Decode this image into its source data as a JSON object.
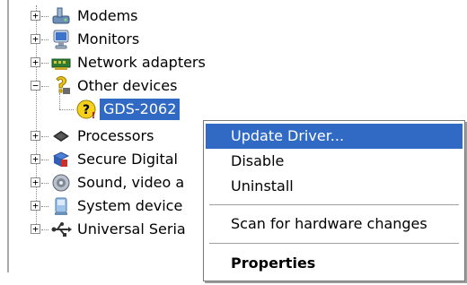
{
  "tree": {
    "items": [
      {
        "label": "Modems",
        "icon": "modem-icon",
        "state": "collapsed"
      },
      {
        "label": "Monitors",
        "icon": "monitor-icon",
        "state": "collapsed"
      },
      {
        "label": "Network adapters",
        "icon": "network-adapter-icon",
        "state": "collapsed"
      },
      {
        "label": "Other devices",
        "icon": "unknown-device-icon",
        "state": "expanded"
      },
      {
        "label": "Processors",
        "icon": "processor-icon",
        "state": "collapsed"
      },
      {
        "label": "Secure Digital",
        "icon": "sd-host-icon",
        "state": "collapsed"
      },
      {
        "label": "Sound, video a",
        "icon": "sound-icon",
        "state": "collapsed"
      },
      {
        "label": "System device",
        "icon": "system-device-icon",
        "state": "collapsed"
      },
      {
        "label": "Universal Seria",
        "icon": "usb-icon",
        "state": "collapsed"
      }
    ],
    "child": {
      "label": "GDS-2062",
      "icon": "unknown-device-warning-icon",
      "selected": true
    },
    "expander_collapsed": "+",
    "expander_expanded": "−"
  },
  "context_menu": {
    "items": [
      {
        "label": "Update Driver...",
        "highlighted": true
      },
      {
        "label": "Disable"
      },
      {
        "label": "Uninstall"
      },
      {
        "label": "Scan for hardware changes"
      },
      {
        "label": "Properties",
        "bold": true
      }
    ]
  },
  "colors": {
    "selection": "#316ac5",
    "text": "#000000",
    "selection_text": "#ffffff"
  }
}
